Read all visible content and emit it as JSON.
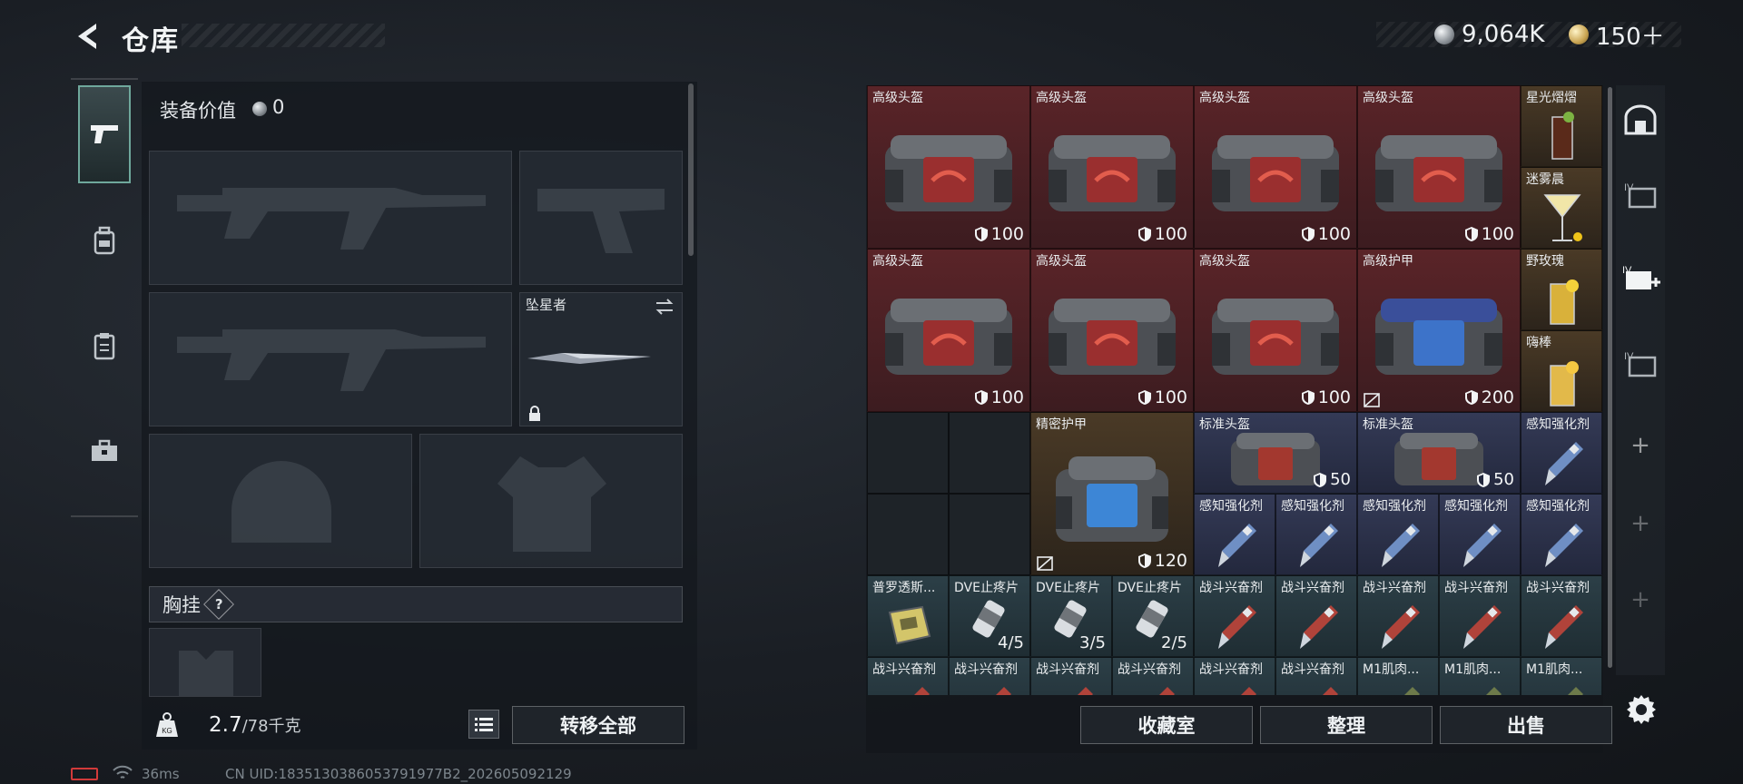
{
  "header": {
    "title": "仓库",
    "silver": "9,064K",
    "gold": "150＋"
  },
  "equipment": {
    "value_label": "装备价值",
    "value": "0",
    "melee_name": "坠星者",
    "chest_label": "胸挂",
    "chest_help": "?"
  },
  "footer": {
    "weight_value": "2.7",
    "weight_max": "/78千克",
    "transfer_all": "转移全部",
    "collection": "收藏室",
    "organize": "整理",
    "sell": "出售"
  },
  "status": {
    "ping": "36ms",
    "uid": "CN UID:1835130386053791977B2_202605092129"
  },
  "inventory": {
    "row1": [
      {
        "name": "高级头盔",
        "dur": "100"
      },
      {
        "name": "高级头盔",
        "dur": "100"
      },
      {
        "name": "高级头盔",
        "dur": "100"
      },
      {
        "name": "高级头盔",
        "dur": "100"
      }
    ],
    "row2": [
      {
        "name": "高级头盔",
        "dur": "100"
      },
      {
        "name": "高级头盔",
        "dur": "100"
      },
      {
        "name": "高级头盔",
        "dur": "100"
      },
      {
        "name": "高级护甲",
        "dur": "200"
      }
    ],
    "drinks": [
      "星光熠熠",
      "迷雾晨",
      "野玫瑰",
      "嗨棒"
    ],
    "precise_armor": {
      "name": "精密护甲",
      "dur": "120"
    },
    "std_helmets": [
      {
        "name": "标准头盔",
        "dur": "50"
      },
      {
        "name": "标准头盔",
        "dur": "50"
      }
    ],
    "sensory_top": "感知强化剂",
    "sensory_row": [
      "感知强化剂",
      "感知强化剂",
      "感知强化剂",
      "感知强化剂",
      "感知强化剂"
    ],
    "row5": [
      {
        "name": "普罗透斯...",
        "qty": ""
      },
      {
        "name": "DVE止疼片",
        "qty": "4/5"
      },
      {
        "name": "DVE止疼片",
        "qty": "3/5"
      },
      {
        "name": "DVE止疼片",
        "qty": "2/5"
      },
      {
        "name": "战斗兴奋剂",
        "qty": ""
      },
      {
        "name": "战斗兴奋剂",
        "qty": ""
      },
      {
        "name": "战斗兴奋剂",
        "qty": ""
      },
      {
        "name": "战斗兴奋剂",
        "qty": ""
      },
      {
        "name": "战斗兴奋剂",
        "qty": ""
      }
    ],
    "row6": [
      "战斗兴奋剂",
      "战斗兴奋剂",
      "战斗兴奋剂",
      "战斗兴奋剂",
      "战斗兴奋剂",
      "战斗兴奋剂",
      "M1肌肉...",
      "M1肌肉...",
      "M1肌肉..."
    ]
  },
  "colors": {
    "rare_red": "#5a2428",
    "gold": "#4a3a26",
    "blue": "#343a56",
    "accent": "#6fa89c"
  },
  "icons": [
    "back-arrow-icon",
    "silver-coin-icon",
    "gold-coin-icon",
    "pistol-icon",
    "backpack-icon",
    "clipboard-icon",
    "toolbox-icon",
    "shield-icon",
    "lock-icon",
    "swap-icon",
    "weight-icon",
    "list-icon",
    "gear-icon",
    "safe-box-icon",
    "container-icon",
    "container-plus-icon",
    "plus-icon"
  ]
}
